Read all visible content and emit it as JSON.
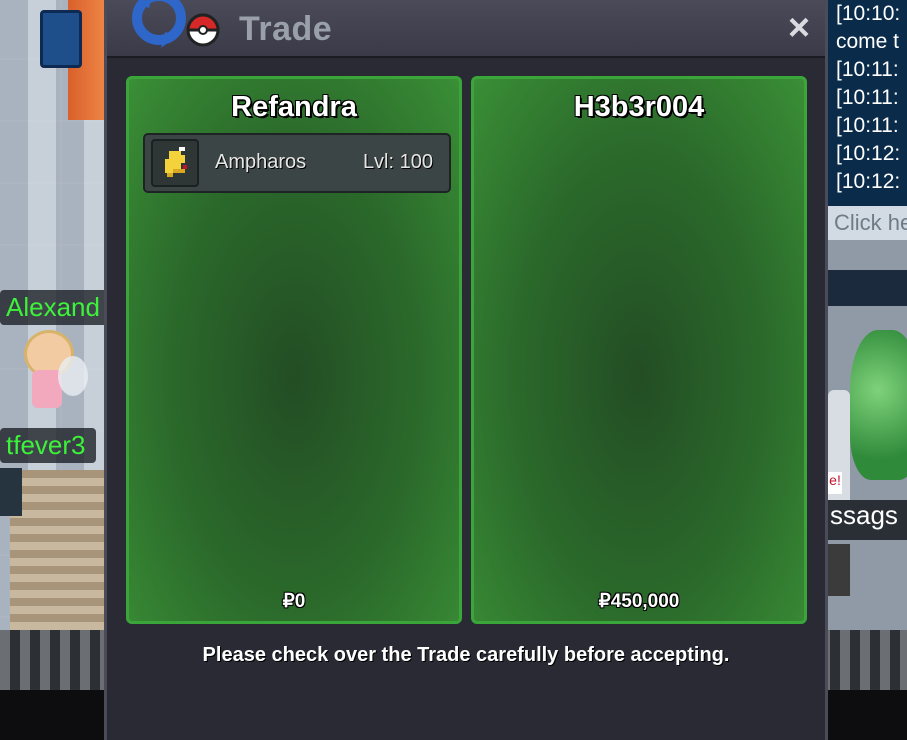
{
  "window": {
    "title": "Trade",
    "close_icon": "×"
  },
  "left_panel": {
    "player_name": "Refandra",
    "items": [
      {
        "name": "Ampharos",
        "level": "Lvl: 100",
        "icon": "ampharos-sprite-icon"
      }
    ],
    "money": "₽0"
  },
  "right_panel": {
    "player_name": "H3b3r004",
    "items": [],
    "money": "₽450,000"
  },
  "notice": "Please check over the Trade carefully before accepting.",
  "chat": {
    "lines": [
      "[10:10:",
      "come t",
      "[10:11:",
      "[10:11:",
      "[10:11:",
      "[10:12:",
      "[10:12:"
    ],
    "input_placeholder": "Click he"
  },
  "world": {
    "nametags": [
      "Alexand",
      "tfever3"
    ],
    "message_label": "ssags",
    "sign": "e!"
  },
  "colors": {
    "panel_green": "#2b6a2b",
    "panel_border": "#3aa63a",
    "window_bg": "#2a2a35",
    "nametag_green": "#3df23a",
    "chat_bg": "#0a2b4a"
  }
}
